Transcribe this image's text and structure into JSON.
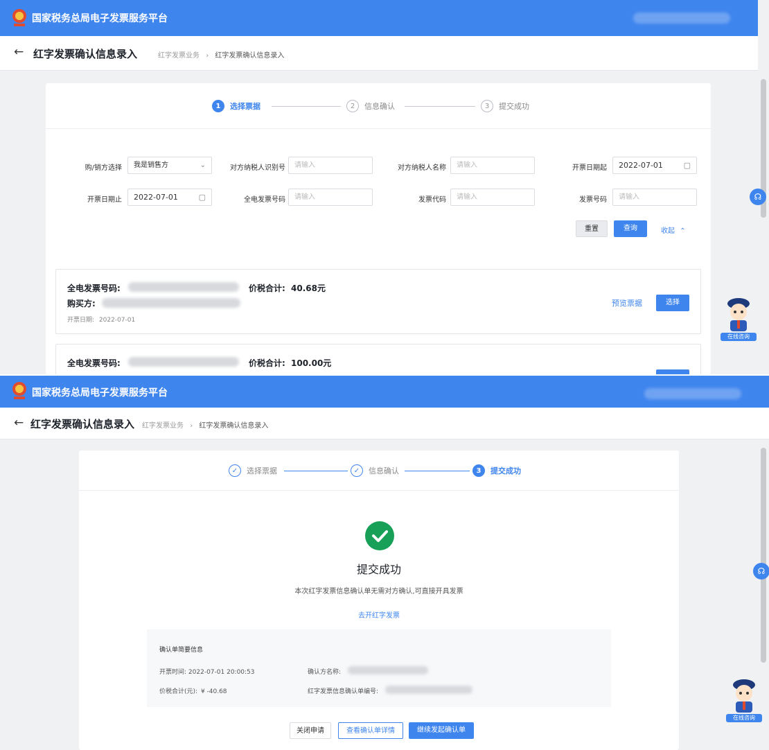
{
  "app": {
    "title": "国家税务总局电子发票服务平台"
  },
  "page": {
    "title": "红字发票确认信息录入",
    "breadcrumb_parent": "红字发票业务",
    "breadcrumb_sep": "›",
    "breadcrumb_current": "红字发票确认信息录入",
    "back_icon": "←"
  },
  "steps": [
    {
      "num": "1",
      "label": "选择票据"
    },
    {
      "num": "2",
      "label": "信息确认"
    },
    {
      "num": "3",
      "label": "提交成功"
    }
  ],
  "filters": {
    "role_label": "购/销方选择",
    "role_value": "我是销售方",
    "buyer_tax_label": "对方纳税人识别号",
    "buyer_tax_placeholder": "请输入",
    "buyer_name_label": "对方纳税人名称",
    "buyer_name_placeholder": "请输入",
    "date_start_label": "开票日期起",
    "date_start_value": "2022-07-01",
    "date_end_label": "开票日期止",
    "date_end_value": "2022-07-01",
    "invoice_num_label": "全电发票号码",
    "invoice_num_placeholder": "请输入",
    "invoice_code_label": "发票代码",
    "invoice_code_placeholder": "请输入",
    "invoice_no_label": "发票号码",
    "invoice_no_placeholder": "请输入",
    "reset_button": "重置",
    "query_button": "查询",
    "collapse_link": "收起"
  },
  "results": [
    {
      "invoice_label": "全电发票号码:",
      "total_label": "价税合计:",
      "total_value": "40.68元",
      "buyer_label": "购买方:",
      "date_label": "开票日期:",
      "date_value": "2022-07-01",
      "preview_link": "预览票据",
      "select_button": "选择"
    },
    {
      "invoice_label": "全电发票号码:",
      "total_label": "价税合计:",
      "total_value": "100.00元"
    }
  ],
  "success": {
    "title": "提交成功",
    "message": "本次红字发票信息确认单无需对方确认,可直接开具发票",
    "issue_link": "去开红字发票",
    "info_heading": "确认单简要信息",
    "entry_time_label": "开票时间:",
    "entry_time_value": "2022-07-01 20:00:53",
    "amount_label": "价税合计(元):",
    "amount_value": "¥ -40.68",
    "counterparty_label": "确认方名称:",
    "confirm_no_label": "红字发票信息确认单编号:",
    "close_button": "关闭申请",
    "view_button": "查看确认单详情",
    "continue_button": "继续发起确认单"
  },
  "assistant": {
    "label": "在线咨询"
  },
  "colors": {
    "brand": "#3f85ee",
    "success": "#18a058"
  },
  "icons": {
    "headset": "headset-icon",
    "calendar": "calendar-icon",
    "chevron": "chevron-down-icon"
  }
}
